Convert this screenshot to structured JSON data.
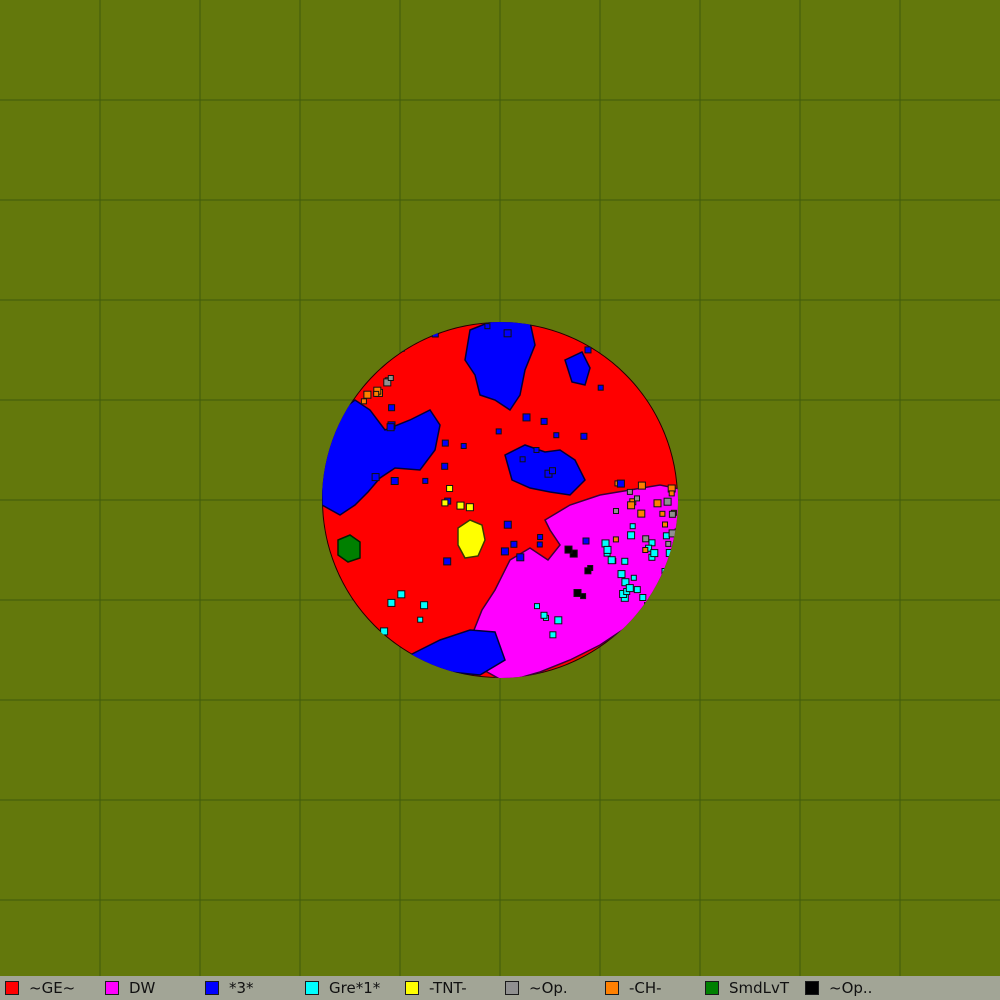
{
  "map": {
    "background": "#63780c",
    "grid_color": "#3f5a0c",
    "territory_colors": {
      "ge": "#ff0000",
      "dw": "#ff00ff",
      "three": "#0000ff",
      "gre": "#00ffff",
      "tnt": "#ffff00",
      "op_gray": "#909090",
      "ch": "#ff8000",
      "smd": "#008000",
      "op_black": "#000000"
    }
  },
  "legend": [
    {
      "label": "~GE~",
      "color": "#ff0000"
    },
    {
      "label": "DW",
      "color": "#ff00ff"
    },
    {
      "label": "*3*",
      "color": "#0000ff"
    },
    {
      "label": "Gre*1*",
      "color": "#00ffff"
    },
    {
      "label": "-TNT-",
      "color": "#ffff00"
    },
    {
      "label": "~Op.",
      "color": "#909090"
    },
    {
      "label": "-CH-",
      "color": "#ff8000"
    },
    {
      "label": "SmdLvT",
      "color": "#008000"
    },
    {
      "label": "~Op..",
      "color": "#000000"
    }
  ]
}
